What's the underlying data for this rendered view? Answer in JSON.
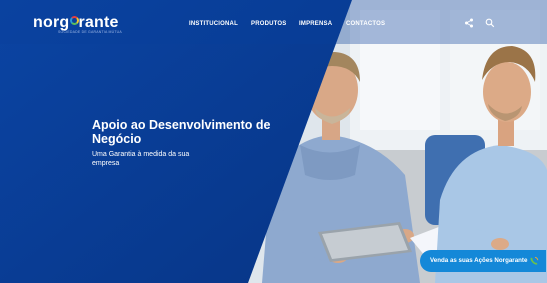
{
  "header": {
    "logo_text": "norgarante",
    "logo_prefix": "norg",
    "logo_o": "a",
    "logo_suffix": "rante",
    "tagline": "SOCIEDADE DE GARANTIA MÚTUA",
    "nav": [
      "INSTITUCIONAL",
      "PRODUTOS",
      "IMPRENSA",
      "CONTACTOS"
    ],
    "share_icon": "share-icon",
    "search_icon": "search-icon"
  },
  "hero": {
    "headline": "Apoio ao Desenvolvimento de Negócio",
    "subline": "Uma Garantia à medida da sua empresa"
  },
  "cta": {
    "label": "Venda as suas Ações Norgarante",
    "icon": "phone-icon"
  },
  "colors": {
    "brand_blue": "#0a3f9a",
    "cta_blue": "#1488d8",
    "cta_icon_green": "#6cc24a",
    "cta_icon_orange": "#f0a830"
  }
}
